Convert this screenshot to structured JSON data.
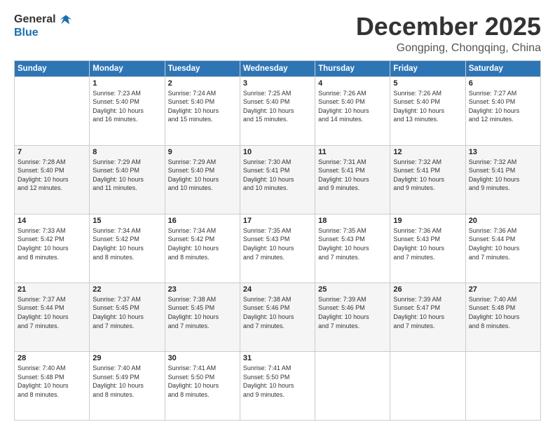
{
  "logo": {
    "general": "General",
    "blue": "Blue"
  },
  "header": {
    "month": "December 2025",
    "location": "Gongping, Chongqing, China"
  },
  "weekdays": [
    "Sunday",
    "Monday",
    "Tuesday",
    "Wednesday",
    "Thursday",
    "Friday",
    "Saturday"
  ],
  "weeks": [
    [
      {
        "day": "",
        "info": ""
      },
      {
        "day": "1",
        "info": "Sunrise: 7:23 AM\nSunset: 5:40 PM\nDaylight: 10 hours\nand 16 minutes."
      },
      {
        "day": "2",
        "info": "Sunrise: 7:24 AM\nSunset: 5:40 PM\nDaylight: 10 hours\nand 15 minutes."
      },
      {
        "day": "3",
        "info": "Sunrise: 7:25 AM\nSunset: 5:40 PM\nDaylight: 10 hours\nand 15 minutes."
      },
      {
        "day": "4",
        "info": "Sunrise: 7:26 AM\nSunset: 5:40 PM\nDaylight: 10 hours\nand 14 minutes."
      },
      {
        "day": "5",
        "info": "Sunrise: 7:26 AM\nSunset: 5:40 PM\nDaylight: 10 hours\nand 13 minutes."
      },
      {
        "day": "6",
        "info": "Sunrise: 7:27 AM\nSunset: 5:40 PM\nDaylight: 10 hours\nand 12 minutes."
      }
    ],
    [
      {
        "day": "7",
        "info": "Sunrise: 7:28 AM\nSunset: 5:40 PM\nDaylight: 10 hours\nand 12 minutes."
      },
      {
        "day": "8",
        "info": "Sunrise: 7:29 AM\nSunset: 5:40 PM\nDaylight: 10 hours\nand 11 minutes."
      },
      {
        "day": "9",
        "info": "Sunrise: 7:29 AM\nSunset: 5:40 PM\nDaylight: 10 hours\nand 10 minutes."
      },
      {
        "day": "10",
        "info": "Sunrise: 7:30 AM\nSunset: 5:41 PM\nDaylight: 10 hours\nand 10 minutes."
      },
      {
        "day": "11",
        "info": "Sunrise: 7:31 AM\nSunset: 5:41 PM\nDaylight: 10 hours\nand 9 minutes."
      },
      {
        "day": "12",
        "info": "Sunrise: 7:32 AM\nSunset: 5:41 PM\nDaylight: 10 hours\nand 9 minutes."
      },
      {
        "day": "13",
        "info": "Sunrise: 7:32 AM\nSunset: 5:41 PM\nDaylight: 10 hours\nand 9 minutes."
      }
    ],
    [
      {
        "day": "14",
        "info": "Sunrise: 7:33 AM\nSunset: 5:42 PM\nDaylight: 10 hours\nand 8 minutes."
      },
      {
        "day": "15",
        "info": "Sunrise: 7:34 AM\nSunset: 5:42 PM\nDaylight: 10 hours\nand 8 minutes."
      },
      {
        "day": "16",
        "info": "Sunrise: 7:34 AM\nSunset: 5:42 PM\nDaylight: 10 hours\nand 8 minutes."
      },
      {
        "day": "17",
        "info": "Sunrise: 7:35 AM\nSunset: 5:43 PM\nDaylight: 10 hours\nand 7 minutes."
      },
      {
        "day": "18",
        "info": "Sunrise: 7:35 AM\nSunset: 5:43 PM\nDaylight: 10 hours\nand 7 minutes."
      },
      {
        "day": "19",
        "info": "Sunrise: 7:36 AM\nSunset: 5:43 PM\nDaylight: 10 hours\nand 7 minutes."
      },
      {
        "day": "20",
        "info": "Sunrise: 7:36 AM\nSunset: 5:44 PM\nDaylight: 10 hours\nand 7 minutes."
      }
    ],
    [
      {
        "day": "21",
        "info": "Sunrise: 7:37 AM\nSunset: 5:44 PM\nDaylight: 10 hours\nand 7 minutes."
      },
      {
        "day": "22",
        "info": "Sunrise: 7:37 AM\nSunset: 5:45 PM\nDaylight: 10 hours\nand 7 minutes."
      },
      {
        "day": "23",
        "info": "Sunrise: 7:38 AM\nSunset: 5:45 PM\nDaylight: 10 hours\nand 7 minutes."
      },
      {
        "day": "24",
        "info": "Sunrise: 7:38 AM\nSunset: 5:46 PM\nDaylight: 10 hours\nand 7 minutes."
      },
      {
        "day": "25",
        "info": "Sunrise: 7:39 AM\nSunset: 5:46 PM\nDaylight: 10 hours\nand 7 minutes."
      },
      {
        "day": "26",
        "info": "Sunrise: 7:39 AM\nSunset: 5:47 PM\nDaylight: 10 hours\nand 7 minutes."
      },
      {
        "day": "27",
        "info": "Sunrise: 7:40 AM\nSunset: 5:48 PM\nDaylight: 10 hours\nand 8 minutes."
      }
    ],
    [
      {
        "day": "28",
        "info": "Sunrise: 7:40 AM\nSunset: 5:48 PM\nDaylight: 10 hours\nand 8 minutes."
      },
      {
        "day": "29",
        "info": "Sunrise: 7:40 AM\nSunset: 5:49 PM\nDaylight: 10 hours\nand 8 minutes."
      },
      {
        "day": "30",
        "info": "Sunrise: 7:41 AM\nSunset: 5:50 PM\nDaylight: 10 hours\nand 8 minutes."
      },
      {
        "day": "31",
        "info": "Sunrise: 7:41 AM\nSunset: 5:50 PM\nDaylight: 10 hours\nand 9 minutes."
      },
      {
        "day": "",
        "info": ""
      },
      {
        "day": "",
        "info": ""
      },
      {
        "day": "",
        "info": ""
      }
    ]
  ]
}
